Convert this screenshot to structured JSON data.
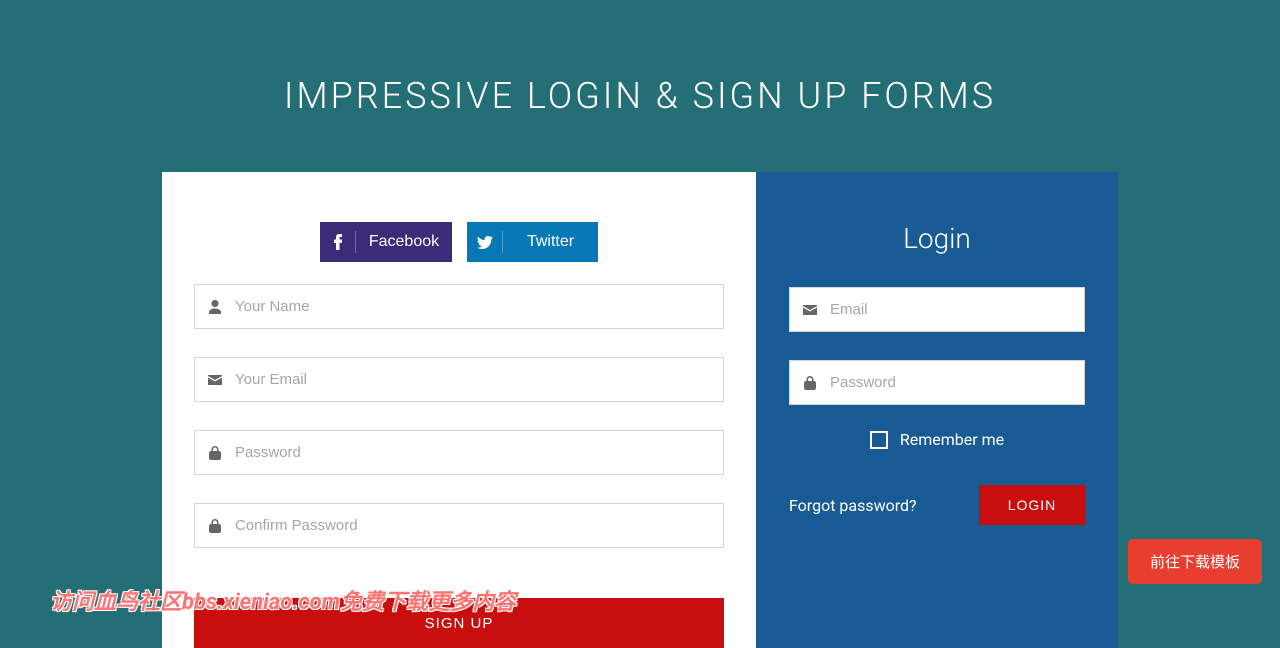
{
  "page": {
    "title": "IMPRESSIVE LOGIN & SIGN UP FORMS"
  },
  "signup": {
    "social": {
      "facebook": "Facebook",
      "twitter": "Twitter"
    },
    "fields": {
      "name_placeholder": "Your Name",
      "email_placeholder": "Your Email",
      "password_placeholder": "Password",
      "confirm_placeholder": "Confirm Password"
    },
    "submit_label": "SIGN UP"
  },
  "login": {
    "heading": "Login",
    "fields": {
      "email_placeholder": "Email",
      "password_placeholder": "Password"
    },
    "remember_label": "Remember me",
    "forgot_label": "Forgot password?",
    "submit_label": "LOGIN"
  },
  "overlay": {
    "watermark": "访问血鸟社区bbs.xieniao.com免费下载更多内容",
    "float_button": "前往下载模板"
  }
}
